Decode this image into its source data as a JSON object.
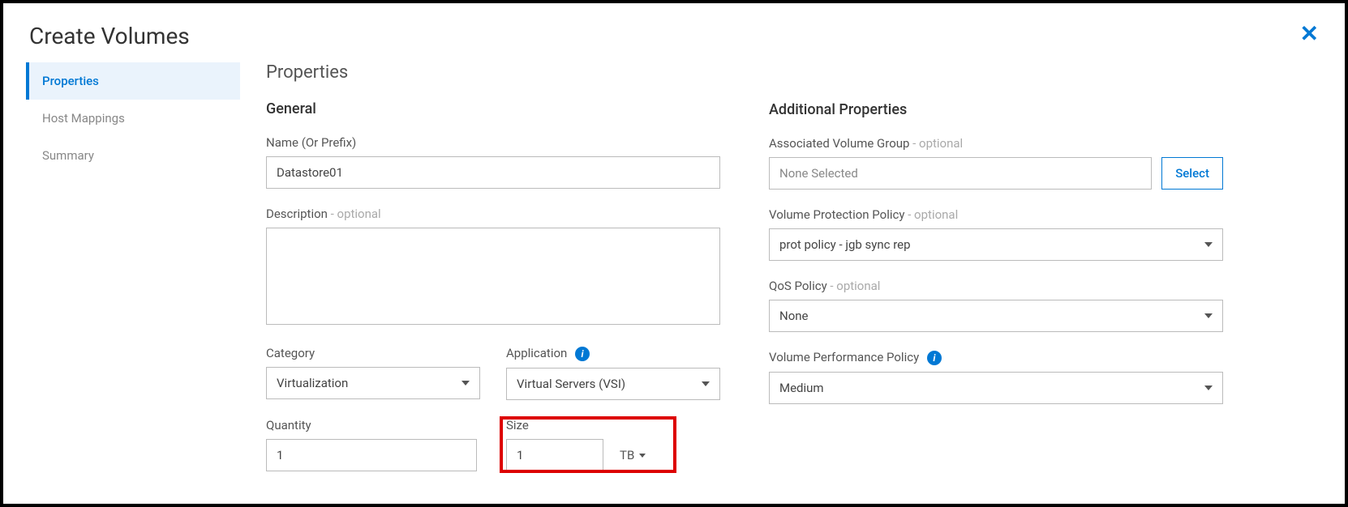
{
  "page": {
    "title": "Create Volumes"
  },
  "sidebar": {
    "items": [
      {
        "label": "Properties",
        "active": true
      },
      {
        "label": "Host Mappings",
        "active": false
      },
      {
        "label": "Summary",
        "active": false
      }
    ]
  },
  "section": {
    "title": "Properties"
  },
  "general": {
    "title": "General",
    "name_label": "Name (Or Prefix)",
    "name_value": "Datastore01",
    "desc_label": "Description",
    "desc_opt": " - optional",
    "desc_value": "",
    "category_label": "Category",
    "category_value": "Virtualization",
    "application_label": "Application",
    "application_value": "Virtual Servers (VSI)",
    "quantity_label": "Quantity",
    "quantity_value": "1",
    "size_label": "Size",
    "size_value": "1",
    "size_unit": "TB"
  },
  "additional": {
    "title": "Additional Properties",
    "avg_label": "Associated Volume Group",
    "avg_opt": " - optional",
    "avg_value": "None Selected",
    "avg_select": "Select",
    "vpp_label": "Volume Protection Policy",
    "vpp_opt": " - optional",
    "vpp_value": "prot policy - jgb sync rep",
    "qos_label": "QoS Policy",
    "qos_opt": " - optional",
    "qos_value": "None",
    "perf_label": "Volume Performance Policy",
    "perf_value": "Medium"
  }
}
